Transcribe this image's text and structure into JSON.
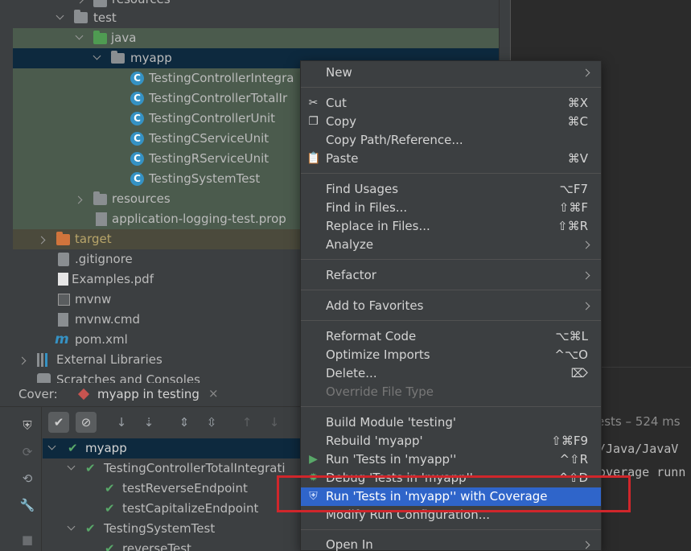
{
  "tree": {
    "rows": [
      {
        "label": "resources",
        "icon": "resources-folder-icon"
      },
      {
        "label": "test",
        "icon": "folder-icon"
      },
      {
        "label": "java",
        "icon": "test-folder-icon"
      },
      {
        "label": "myapp",
        "icon": "package-icon"
      },
      {
        "label": "TestingControllerIntegra",
        "icon": "class-icon"
      },
      {
        "label": "TestingControllerTotalIr",
        "icon": "class-icon"
      },
      {
        "label": "TestingControllerUnit",
        "icon": "class-icon"
      },
      {
        "label": "TestingCServiceUnit",
        "icon": "class-icon"
      },
      {
        "label": "TestingRServiceUnit",
        "icon": "class-icon"
      },
      {
        "label": "TestingSystemTest",
        "icon": "class-icon"
      },
      {
        "label": "resources",
        "icon": "resources-folder-icon"
      },
      {
        "label": "application-logging-test.prop",
        "icon": "properties-file-icon"
      },
      {
        "label": "target",
        "icon": "excluded-folder-icon"
      },
      {
        "label": ".gitignore",
        "icon": "gitignore-file-icon"
      },
      {
        "label": "Examples.pdf",
        "icon": "pdf-file-icon"
      },
      {
        "label": "mvnw",
        "icon": "script-file-icon"
      },
      {
        "label": "mvnw.cmd",
        "icon": "text-file-icon"
      },
      {
        "label": "pom.xml",
        "icon": "maven-file-icon"
      },
      {
        "label": "External Libraries",
        "icon": "libraries-icon"
      },
      {
        "label": "Scratches and Consoles",
        "icon": "scratches-icon"
      }
    ],
    "class_icon_letter": "C"
  },
  "cover": {
    "title": "Cover:",
    "tab_label": "myapp in testing",
    "tab_close": "×",
    "tests": [
      {
        "label": "myapp"
      },
      {
        "label": "TestingControllerTotalIntegrati"
      },
      {
        "label": "testReverseEndpoint"
      },
      {
        "label": "testCapitalizeEndpoint"
      },
      {
        "label": "TestingSystemTest"
      },
      {
        "label": "reverseTest"
      }
    ]
  },
  "editor": {
    "status_fragment": "ests – 524 ms",
    "path_fragment": "/Java/JavaV",
    "runner_fragment": "overage runn"
  },
  "menu": {
    "items": {
      "new": {
        "label": "New",
        "key": ""
      },
      "cut": {
        "label": "Cut",
        "key": "⌘X"
      },
      "copy": {
        "label": "Copy",
        "key": "⌘C"
      },
      "copy_path": {
        "label": "Copy Path/Reference...",
        "key": ""
      },
      "paste": {
        "label": "Paste",
        "key": "⌘V"
      },
      "find_usages": {
        "label": "Find Usages",
        "key": "⌥F7"
      },
      "find_in_files": {
        "label": "Find in Files...",
        "key": "⇧⌘F"
      },
      "replace_in_files": {
        "label": "Replace in Files...",
        "key": "⇧⌘R"
      },
      "analyze": {
        "label": "Analyze",
        "key": ""
      },
      "refactor": {
        "label": "Refactor",
        "key": ""
      },
      "add_favorites": {
        "label": "Add to Favorites",
        "key": ""
      },
      "reformat": {
        "label": "Reformat Code",
        "key": "⌥⌘L"
      },
      "optimize": {
        "label": "Optimize Imports",
        "key": "^⌥O"
      },
      "delete": {
        "label": "Delete...",
        "key": "⌦"
      },
      "override": {
        "label": "Override File Type",
        "key": ""
      },
      "build_module": {
        "label": "Build Module 'testing'",
        "key": ""
      },
      "rebuild": {
        "label": "Rebuild 'myapp'",
        "key": "⇧⌘F9"
      },
      "run_tests": {
        "label": "Run 'Tests in 'myapp''",
        "key": "^⇧R"
      },
      "debug_tests": {
        "label": "Debug 'Tests in 'myapp''",
        "key": "^⇧D"
      },
      "run_coverage": {
        "label": "Run 'Tests in 'myapp'' with Coverage",
        "key": ""
      },
      "modify_run": {
        "label": "Modify Run Configuration...",
        "key": ""
      },
      "open_in": {
        "label": "Open In",
        "key": ""
      }
    }
  },
  "colors": {
    "selection": "#2f65ca",
    "highlight_box": "#d0262b",
    "check": "#59a869"
  }
}
